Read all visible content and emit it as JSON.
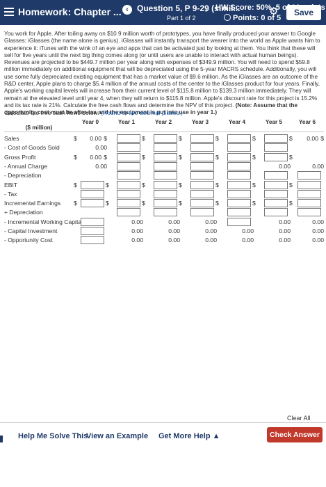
{
  "header": {
    "title": "Homework: Chapter ...",
    "question": "Question 5, P 9-29 (simil...",
    "part": "Part 1 of 2",
    "score": "HW Score: 50%, 5 of 10 points",
    "points": "Points: 0 of 5",
    "save_label": "Save"
  },
  "problem": {
    "text": "You work for Apple. After toiling away on $10.9 million worth of prototypes, you have finally produced your answer to Google Glasses: iGlasses (the name alone is genius). iGlasses will instantly transport the wearer into the world as Apple wants him to experience it: iTunes with the wink of an eye and apps that can be activated just by looking at them. You think that these will sell for five years until the next big thing comes along (or until users are unable to interact with actual human beings). Revenues are projected to be $449.7 million per year along with expenses of $349.9 million. You will need to spend $59.8 million immediately on additional equipment that will be depreciated using the 5-year MACRS schedule. Additionally, you will use some fully depreciated existing equipment that has a market value of $9.6 million. As the iGlasses are an outcome of the R&D center, Apple plans to charge $5.4 million of the annual costs of the center to the iGlasses product for four years. Finally, Apple's working capital levels will increase from their current level of $115.8 million to $139.3 million immediately. They will remain at the elevated level until year 4, when they will return to $115.8 million. Apple's discount rate for this project is 15.2% and its tax rate is 21%. Calculate the free cash flows and determine the NPV of this project.",
    "note": "(Note: Assume that the opportunity cost must be after-tax and the equipment is put into use in year 1.)"
  },
  "instruction": {
    "text": "Calculate the free cash flows below.",
    "hint": "(Round to two decimal places.)"
  },
  "table": {
    "units_label": "($ million)",
    "columns": [
      "Year 0",
      "Year 1",
      "Year 2",
      "Year 3",
      "Year 4",
      "Year 5",
      "Year 6"
    ],
    "rows": [
      {
        "label": "Sales",
        "cells": [
          "$ 0.00 $",
          "box$",
          "box$",
          "box$",
          "box$",
          "box$",
          "0.00 $"
        ]
      },
      {
        "label": "- Cost of Goods Sold",
        "cells": [
          "0.00",
          "box",
          "box",
          "box",
          "box",
          "box",
          ""
        ]
      },
      {
        "label": "Gross Profit",
        "cells": [
          "$ 0.00 $",
          "box$",
          "box$",
          "box$",
          "box$",
          "box$",
          ""
        ]
      },
      {
        "label": "- Annual Charge",
        "cells": [
          "0.00",
          "box",
          "box",
          "box",
          "box",
          "0.00",
          "0.00"
        ]
      },
      {
        "label": "- Depreciation",
        "cells": [
          "",
          "box",
          "box",
          "box",
          "box",
          "box",
          "box"
        ]
      },
      {
        "label": "EBIT",
        "cells": [
          "$ box$",
          "box$",
          "box$",
          "box$",
          "box$",
          "box$",
          "box"
        ]
      },
      {
        "label": "- Tax",
        "cells": [
          "box",
          "box",
          "box",
          "box",
          "box",
          "box",
          "box"
        ]
      },
      {
        "label": "Incremental Earnings",
        "cells": [
          "$ box$",
          "box$",
          "box$",
          "box$",
          "box$",
          "box$",
          "box"
        ]
      },
      {
        "label": "+ Depreciation",
        "cells": [
          "",
          "box",
          "box",
          "box",
          "box",
          "box",
          "box"
        ]
      },
      {
        "label": "- Incremental Working Capital",
        "cells": [
          "box",
          "0.00",
          "0.00",
          "0.00",
          "box",
          "0.00",
          "0.00"
        ]
      },
      {
        "label": "- Capital Investment",
        "cells": [
          "box",
          "0.00",
          "0.00",
          "0.00",
          "0.00",
          "0.00",
          "0.00"
        ]
      },
      {
        "label": "- Opportunity Cost",
        "cells": [
          "box",
          "0.00",
          "0.00",
          "0.00",
          "0.00",
          "0.00",
          "0.00"
        ]
      }
    ]
  },
  "footer": {
    "clear_all": "Clear All",
    "help": "Help Me Solve This",
    "example": "View an Example",
    "more_help": "Get More Help ▲",
    "check": "Check Answer"
  }
}
